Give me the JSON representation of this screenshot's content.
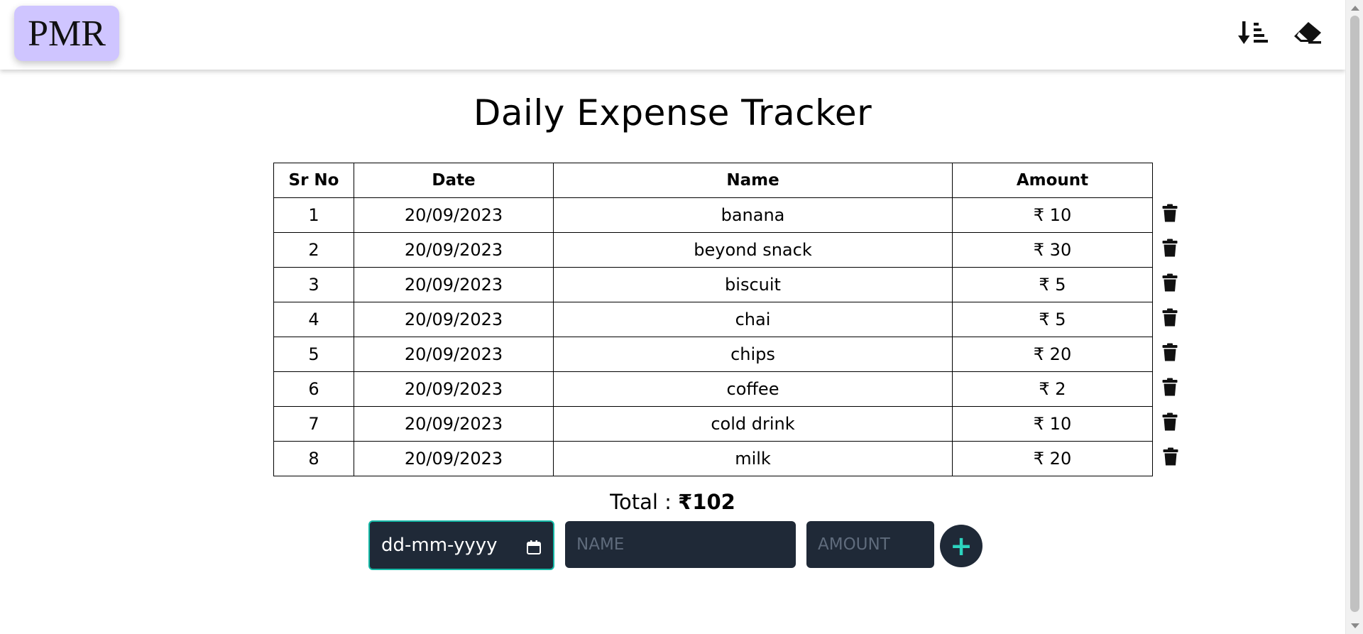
{
  "header": {
    "logo_text": "PMR",
    "sort_icon": "sort-descending-icon",
    "clear_icon": "eraser-icon"
  },
  "title": "Daily Expense Tracker",
  "table": {
    "headers": [
      "Sr No",
      "Date",
      "Name",
      "Amount"
    ],
    "rows": [
      {
        "sr": "1",
        "date": "20/09/2023",
        "name": "banana",
        "amount": "₹ 10"
      },
      {
        "sr": "2",
        "date": "20/09/2023",
        "name": "beyond snack",
        "amount": "₹ 30"
      },
      {
        "sr": "3",
        "date": "20/09/2023",
        "name": "biscuit",
        "amount": "₹ 5"
      },
      {
        "sr": "4",
        "date": "20/09/2023",
        "name": "chai",
        "amount": "₹ 5"
      },
      {
        "sr": "5",
        "date": "20/09/2023",
        "name": "chips",
        "amount": "₹ 20"
      },
      {
        "sr": "6",
        "date": "20/09/2023",
        "name": "coffee",
        "amount": "₹ 2"
      },
      {
        "sr": "7",
        "date": "20/09/2023",
        "name": "cold drink",
        "amount": "₹ 10"
      },
      {
        "sr": "8",
        "date": "20/09/2023",
        "name": "milk",
        "amount": "₹ 20"
      }
    ],
    "delete_icon": "trash-icon"
  },
  "total": {
    "label": "Total : ",
    "value": "₹102"
  },
  "form": {
    "date_placeholder": "dd-mm-yyyy",
    "name_placeholder": "NAME",
    "amount_placeholder": "AMOUNT",
    "add_label": "+"
  },
  "colors": {
    "logo_bg": "#cfc5ff",
    "input_bg": "#1f2937",
    "accent": "#14b8a6"
  }
}
